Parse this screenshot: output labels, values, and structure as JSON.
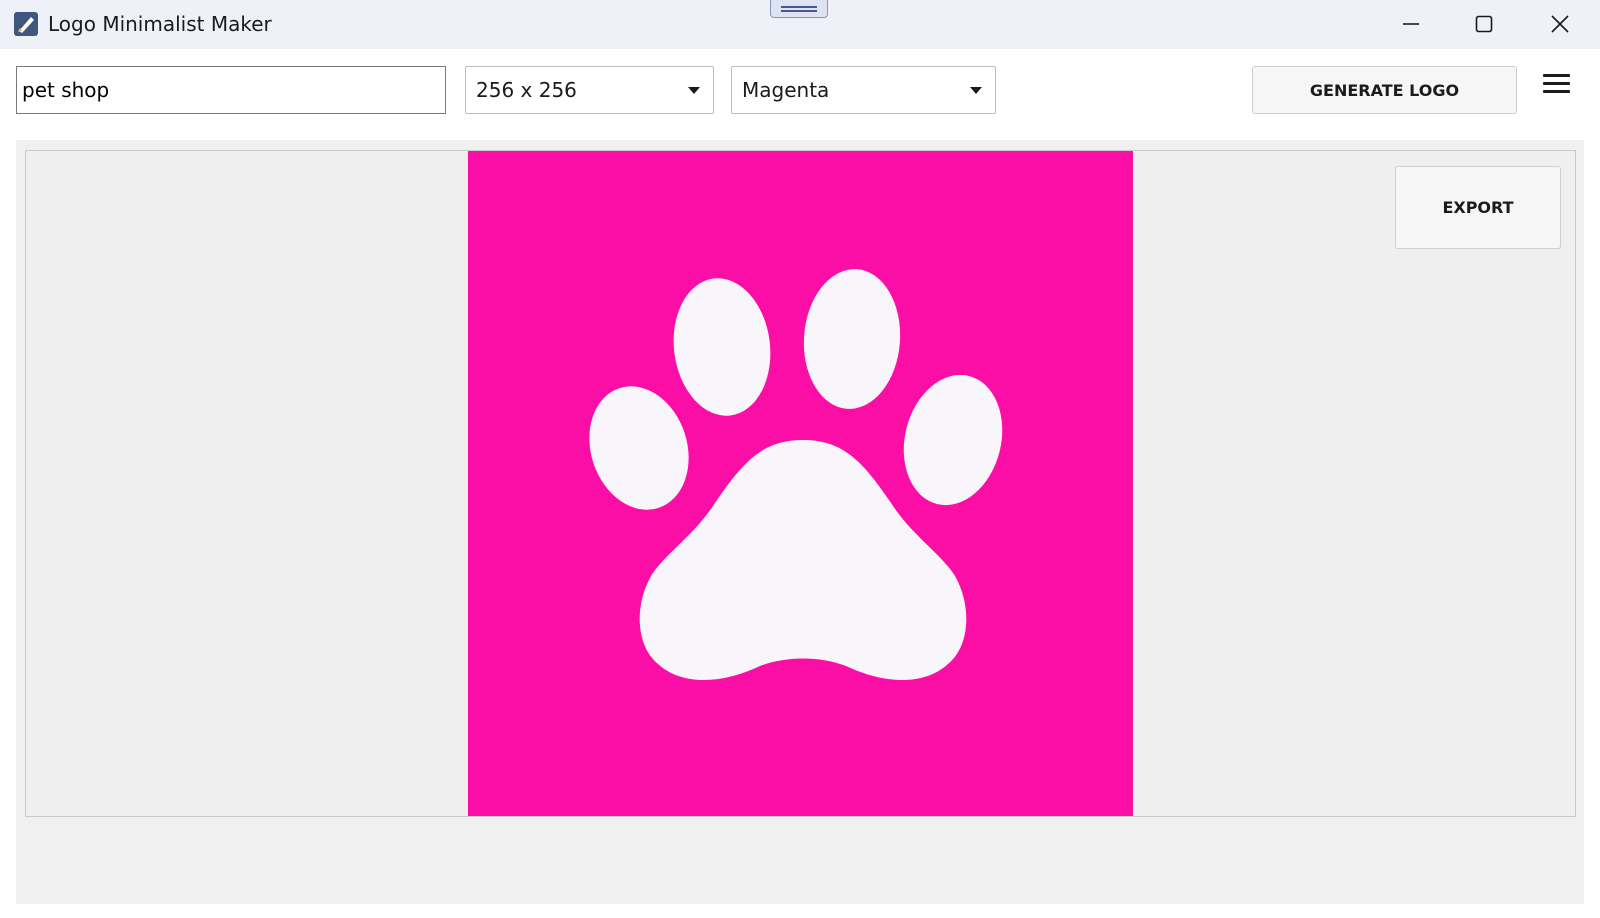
{
  "window": {
    "title": "Logo Minimalist Maker",
    "controls": [
      "minimize",
      "maximize",
      "close"
    ]
  },
  "toolbar": {
    "prompt_value": "pet shop",
    "size_select": "256 x 256",
    "color_select": "Magenta",
    "generate_label": "GENERATE LOGO"
  },
  "canvas": {
    "export_label": "EXPORT",
    "logo": {
      "background_color": "#fb0ea6",
      "symbol_color": "#f9f6fb",
      "icon": "paw-print-icon"
    }
  },
  "icons": [
    "app-icon",
    "minimize-icon",
    "maximize-icon",
    "close-icon",
    "chevron-down-icon",
    "hamburger-menu-icon",
    "paw-print-icon"
  ]
}
